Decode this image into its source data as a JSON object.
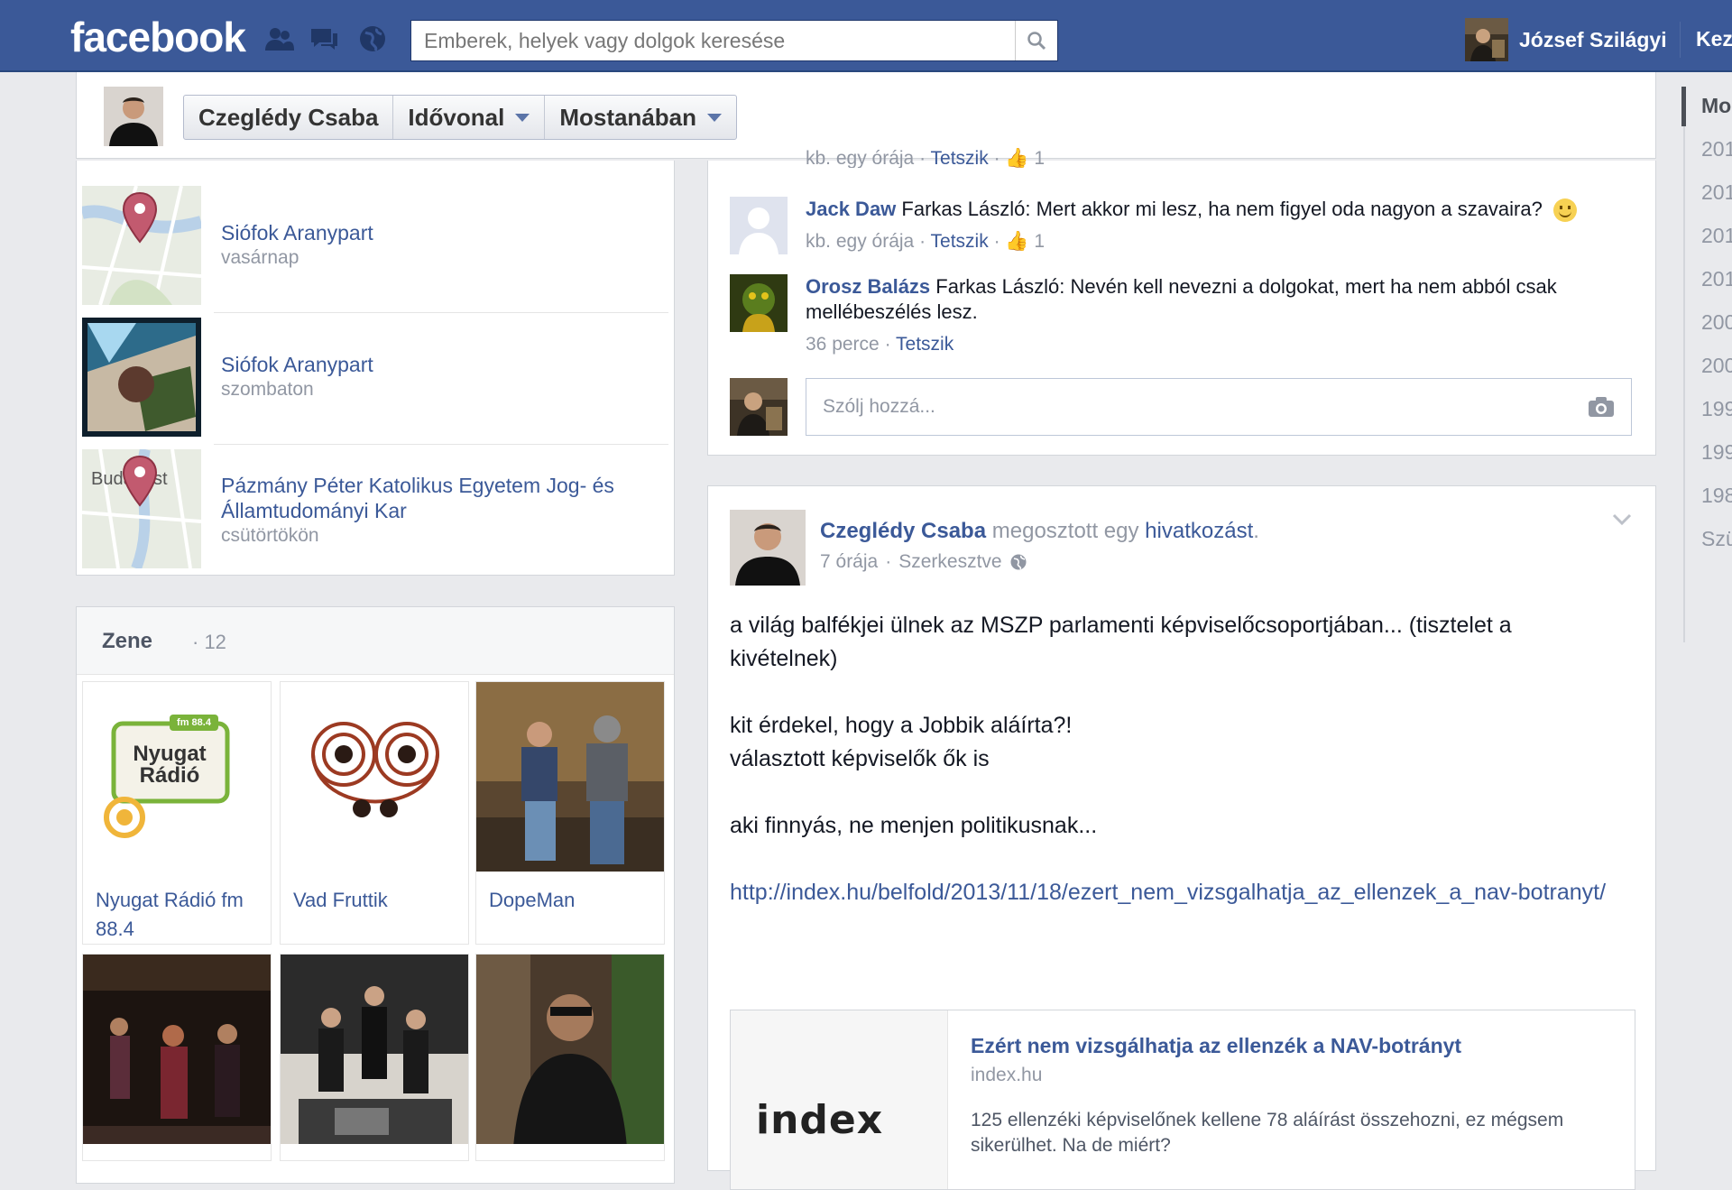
{
  "topbar": {
    "brand": "facebook",
    "search_placeholder": "Emberek, helyek vagy dolgok keresése",
    "user_name": "József Szilágyi",
    "home_label": "Kez"
  },
  "timeline_header": {
    "tabs": [
      "Czeglédy Csaba",
      "Idővonal",
      "Mostanában"
    ]
  },
  "year_rail": [
    "Mo",
    "201",
    "201",
    "201",
    "201",
    "200",
    "200",
    "199",
    "199",
    "198",
    "Szü"
  ],
  "places": [
    {
      "title": "Siófok Aranypart",
      "when": "vasárnap",
      "thumb": "map-pin"
    },
    {
      "title": "Siófok Aranypart",
      "when": "szombaton",
      "thumb": "photo"
    },
    {
      "title": "Pázmány Péter Katolikus Egyetem Jog- és Államtudományi Kar",
      "when": "csütörtökön",
      "thumb": "map-pin",
      "map_label": "Budapest"
    }
  ],
  "music": {
    "title": "Zene",
    "count": "· 12",
    "tiles": [
      {
        "caption": "Nyugat Rádió fm 88.4",
        "logo_text": "Nyugat Rádió",
        "badge_text": "fm 88.4"
      },
      {
        "caption": "Vad Fruttik"
      },
      {
        "caption": "DopeMan"
      },
      {
        "caption": ""
      },
      {
        "caption": ""
      },
      {
        "caption": ""
      }
    ]
  },
  "comments": {
    "top_meta": {
      "time": "kb. egy órája",
      "like": "Tetszik",
      "likes": "1"
    },
    "items": [
      {
        "author": "Jack Daw",
        "text": "Farkas László: Mert akkor mi lesz, ha nem figyel oda nagyon a szavaira?",
        "time": "kb. egy órája",
        "like": "Tetszik",
        "likes": "1"
      },
      {
        "author": "Orosz Balázs",
        "text": "Farkas László: Nevén kell nevezni a dolgokat, mert ha nem abból csak mellébeszélés lesz.",
        "time": "36 perce",
        "like": "Tetszik"
      }
    ],
    "reply_placeholder": "Szólj hozzá..."
  },
  "post": {
    "author": "Czeglédy Csaba",
    "action_pre": "megosztott egy",
    "action_link": "hivatkozást",
    "action_end": ".",
    "time": "7 órája",
    "edited": "Szerkesztve",
    "paragraphs": [
      "a világ balfékjei ülnek az MSZP parlamenti képviselőcsoportjában... (tisztelet a kivételnek)",
      "kit érdekel, hogy a Jobbik aláírta?!\nválasztott képviselők ők is",
      "aki finnyás, ne menjen politikusnak..."
    ],
    "url": "http://index.hu/belfold/2013/11/18/ezert_nem_vizsgalhatja_az_ellenzek_a_nav-botranyt/",
    "share": {
      "logo": "index",
      "title": "Ezért nem vizsgálhatja az ellenzék a NAV-botrányt",
      "domain": "index.hu",
      "description": "125 ellenzéki képviselőnek kellene 78 aláírást összehozni, ez mégsem sikerülhet. Na de miért?"
    }
  },
  "colors": {
    "brand_blue": "#3b5998",
    "link_blue": "#3b5998",
    "muted": "#9197a3"
  }
}
